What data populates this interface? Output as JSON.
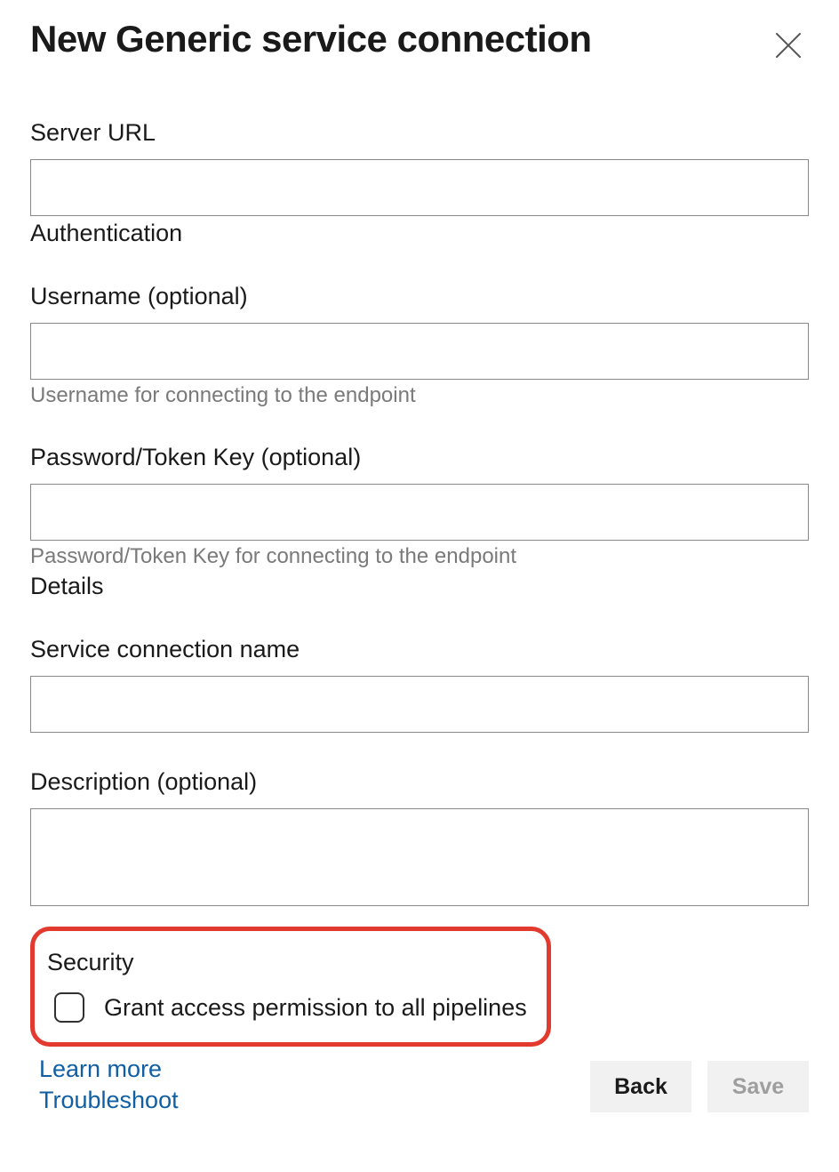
{
  "header": {
    "title": "New Generic service connection"
  },
  "sections": {
    "authentication": "Authentication",
    "details": "Details",
    "security": "Security"
  },
  "fields": {
    "server_url": {
      "label": "Server URL",
      "value": ""
    },
    "username": {
      "label": "Username (optional)",
      "value": "",
      "help": "Username for connecting to the endpoint"
    },
    "password": {
      "label": "Password/Token Key (optional)",
      "value": "",
      "help": "Password/Token Key for connecting to the endpoint"
    },
    "conn_name": {
      "label": "Service connection name",
      "value": ""
    },
    "description": {
      "label": "Description (optional)",
      "value": ""
    }
  },
  "security": {
    "grant_label": "Grant access permission to all pipelines",
    "checked": false
  },
  "links": {
    "learn_more": "Learn more",
    "troubleshoot": "Troubleshoot"
  },
  "buttons": {
    "back": "Back",
    "save": "Save"
  }
}
